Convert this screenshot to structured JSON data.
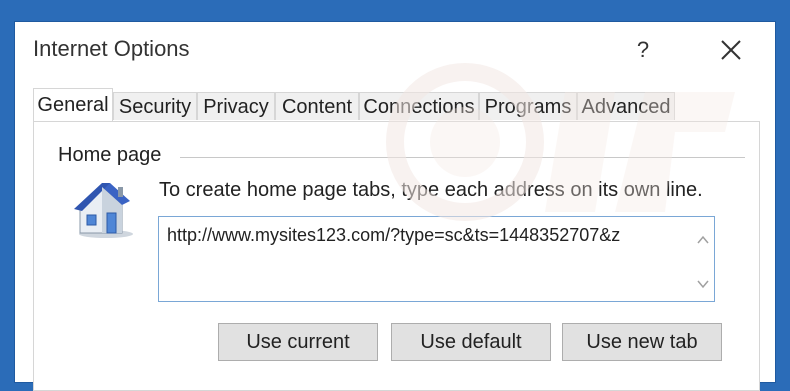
{
  "window": {
    "title": "Internet Options",
    "help_label": "?"
  },
  "tabs": [
    {
      "label": "General",
      "active": true
    },
    {
      "label": "Security",
      "active": false
    },
    {
      "label": "Privacy",
      "active": false
    },
    {
      "label": "Content",
      "active": false
    },
    {
      "label": "Connections",
      "active": false
    },
    {
      "label": "Programs",
      "active": false
    },
    {
      "label": "Advanced",
      "active": false
    }
  ],
  "home_page": {
    "group_label": "Home page",
    "hint": "To create home page tabs, type each address on its own line.",
    "url_value": "http://www.mysites123.com/?type=sc&ts=1448352707&z"
  },
  "buttons": {
    "use_current": "Use current",
    "use_default": "Use default",
    "use_new_tab": "Use new tab"
  },
  "colors": {
    "frame_blue": "#2b6cb8",
    "input_border": "#7aa7d6",
    "button_face": "#e1e1e1"
  },
  "icons": {
    "house": "home-page-icon",
    "close": "close-icon",
    "help": "help-icon",
    "scroll_up": "chevron-up-icon",
    "scroll_down": "chevron-down-icon"
  }
}
